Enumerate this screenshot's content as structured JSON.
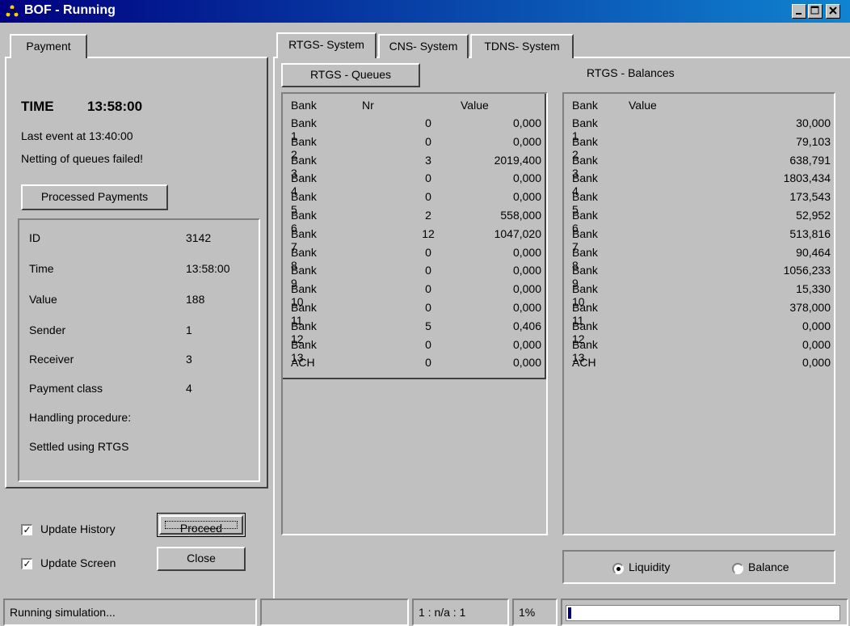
{
  "window": {
    "title": "BOF - Running"
  },
  "left": {
    "tab_label": "Payment",
    "time_label": "TIME",
    "time_value": "13:58:00",
    "last_event": "Last event at  13:40:00",
    "netting_msg": "Netting of queues failed!",
    "processed_button": "Processed Payments",
    "fields": [
      {
        "label": "ID",
        "value": "3142"
      },
      {
        "label": "Time",
        "value": "13:58:00"
      },
      {
        "label": "Value",
        "value": "188"
      },
      {
        "label": "Sender",
        "value": "1"
      },
      {
        "label": "Receiver",
        "value": "3"
      },
      {
        "label": "Payment class",
        "value": "4"
      },
      {
        "label": "Handling procedure:",
        "value": ""
      },
      {
        "label": "Settled using RTGS",
        "value": ""
      }
    ],
    "update_history": {
      "label": "Update History",
      "checked": true
    },
    "update_screen": {
      "label": "Update Screen",
      "checked": true
    },
    "proceed_button": "Proceed",
    "close_button": "Close"
  },
  "tabs": [
    "RTGS- System",
    "CNS- System",
    "TDNS- System"
  ],
  "queues": {
    "button": "RTGS - Queues",
    "headers": {
      "bank": "Bank",
      "nr": "Nr",
      "value": "Value"
    },
    "rows": [
      {
        "bank": "Bank 1",
        "nr": "0",
        "value": "0,000"
      },
      {
        "bank": "Bank 2",
        "nr": "0",
        "value": "0,000"
      },
      {
        "bank": "Bank 3",
        "nr": "3",
        "value": "2019,400"
      },
      {
        "bank": "Bank 4",
        "nr": "0",
        "value": "0,000"
      },
      {
        "bank": "Bank 5",
        "nr": "0",
        "value": "0,000"
      },
      {
        "bank": "Bank 6",
        "nr": "2",
        "value": "558,000"
      },
      {
        "bank": "Bank 7",
        "nr": "12",
        "value": "1047,020"
      },
      {
        "bank": "Bank 8",
        "nr": "0",
        "value": "0,000"
      },
      {
        "bank": "Bank 9",
        "nr": "0",
        "value": "0,000"
      },
      {
        "bank": "Bank 10",
        "nr": "0",
        "value": "0,000"
      },
      {
        "bank": "Bank 11",
        "nr": "0",
        "value": "0,000"
      },
      {
        "bank": "Bank 12",
        "nr": "5",
        "value": "0,406"
      },
      {
        "bank": "Bank 13",
        "nr": "0",
        "value": "0,000"
      },
      {
        "bank": "ACH",
        "nr": "0",
        "value": "0,000"
      }
    ]
  },
  "balances": {
    "title": "RTGS - Balances",
    "headers": {
      "bank": "Bank",
      "value": "Value"
    },
    "rows": [
      {
        "bank": "Bank 1",
        "value": "30,000"
      },
      {
        "bank": "Bank 2",
        "value": "79,103"
      },
      {
        "bank": "Bank 3",
        "value": "638,791"
      },
      {
        "bank": "Bank 4",
        "value": "1803,434"
      },
      {
        "bank": "Bank 5",
        "value": "173,543"
      },
      {
        "bank": "Bank 6",
        "value": "52,952"
      },
      {
        "bank": "Bank 7",
        "value": "513,816"
      },
      {
        "bank": "Bank 8",
        "value": "90,464"
      },
      {
        "bank": "Bank 9",
        "value": "1056,233"
      },
      {
        "bank": "Bank 10",
        "value": "15,330"
      },
      {
        "bank": "Bank 11",
        "value": "378,000"
      },
      {
        "bank": "Bank 12",
        "value": "0,000"
      },
      {
        "bank": "Bank 13",
        "value": "0,000"
      },
      {
        "bank": "ACH",
        "value": "0,000"
      }
    ]
  },
  "radio": {
    "options": [
      "Liquidity",
      "Balance"
    ],
    "selected": "Liquidity"
  },
  "status": {
    "message": "Running simulation...",
    "ratio": "1 : n/a : 1",
    "percent": "1%",
    "progress_fraction": 0.01
  }
}
